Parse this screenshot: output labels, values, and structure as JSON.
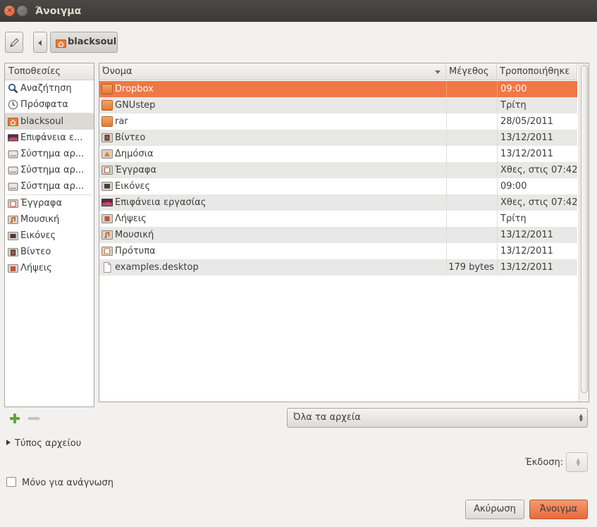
{
  "window": {
    "title": "Άνοιγμα"
  },
  "pathbar": {
    "current": "blacksoul"
  },
  "places": {
    "header": "Τοποθεσίες",
    "groups": [
      [
        {
          "label": "Αναζήτηση",
          "icon": "search-icon"
        },
        {
          "label": "Πρόσφατα",
          "icon": "clock-icon"
        }
      ],
      [
        {
          "label": "blacksoul",
          "icon": "home-folder-icon",
          "selected": true
        },
        {
          "label": "Επιφάνεια ε...",
          "icon": "desktop-icon"
        },
        {
          "label": "Σύστημα αρ...",
          "icon": "drive-icon"
        },
        {
          "label": "Σύστημα αρ...",
          "icon": "drive-icon"
        },
        {
          "label": "Σύστημα αρ...",
          "icon": "drive-icon"
        }
      ],
      [
        {
          "label": "Έγγραφα",
          "icon": "documents-folder-icon"
        },
        {
          "label": "Μουσική",
          "icon": "music-folder-icon"
        },
        {
          "label": "Εικόνες",
          "icon": "pictures-folder-icon"
        },
        {
          "label": "Βίντεο",
          "icon": "videos-folder-icon"
        },
        {
          "label": "Λήψεις",
          "icon": "downloads-folder-icon"
        }
      ]
    ]
  },
  "files": {
    "columns": {
      "name": "Όνομα",
      "size": "Μέγεθος",
      "modified": "Τροποποιήθηκε"
    },
    "rows": [
      {
        "name": "Dropbox",
        "size": "",
        "modified": "09:00",
        "icon": "folder-icon",
        "selected": true
      },
      {
        "name": "GNUstep",
        "size": "",
        "modified": "Τρίτη",
        "icon": "folder-icon"
      },
      {
        "name": "rar",
        "size": "",
        "modified": "28/05/2011",
        "icon": "folder-icon"
      },
      {
        "name": "Βίντεο",
        "size": "",
        "modified": "13/12/2011",
        "icon": "videos-folder-icon"
      },
      {
        "name": "Δημόσια",
        "size": "",
        "modified": "13/12/2011",
        "icon": "public-folder-icon"
      },
      {
        "name": "Έγγραφα",
        "size": "",
        "modified": "Χθες, στις 07:42",
        "icon": "documents-folder-icon"
      },
      {
        "name": "Εικόνες",
        "size": "",
        "modified": "09:00",
        "icon": "pictures-folder-icon"
      },
      {
        "name": "Επιφάνεια εργασίας",
        "size": "",
        "modified": "Χθες, στις 07:42",
        "icon": "desktop-icon"
      },
      {
        "name": "Λήψεις",
        "size": "",
        "modified": "Τρίτη",
        "icon": "downloads-folder-icon"
      },
      {
        "name": "Μουσική",
        "size": "",
        "modified": "13/12/2011",
        "icon": "music-folder-icon"
      },
      {
        "name": "Πρότυπα",
        "size": "",
        "modified": "13/12/2011",
        "icon": "templates-folder-icon"
      },
      {
        "name": "examples.desktop",
        "size": "179 bytes",
        "modified": "13/12/2011",
        "icon": "file-icon"
      }
    ]
  },
  "filter": {
    "selected": "Όλα τα αρχεία"
  },
  "filetype_expander": {
    "label": "Τύπος αρχείου"
  },
  "version": {
    "label": "Έκδοση:"
  },
  "readonly": {
    "label": "Μόνο για ανάγνωση"
  },
  "buttons": {
    "cancel": "Ακύρωση",
    "open": "Άνοιγμα"
  },
  "colors": {
    "accent": "#f07746",
    "titlebar": "#3c3b37"
  }
}
